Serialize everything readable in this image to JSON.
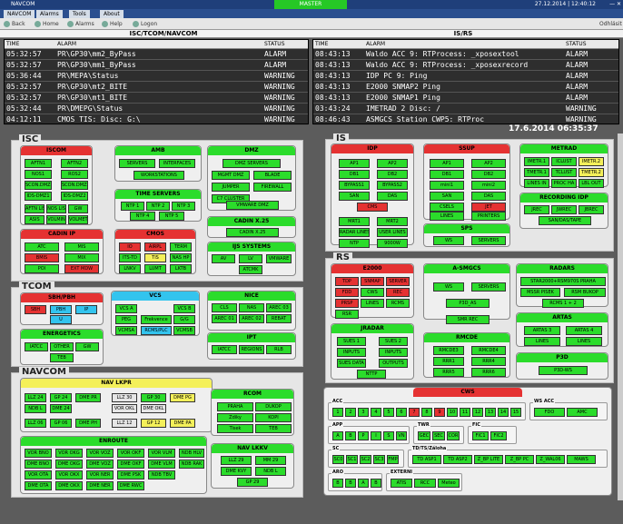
{
  "app": {
    "title": "NAVCOM",
    "master": "MASTER",
    "datetime": "27.12.2014 | 12:40:12",
    "winbtns": "— ✕",
    "offline": "Odhlásit"
  },
  "menu": [
    "NAVCOM",
    "Alarms",
    "Tools",
    "About"
  ],
  "toolbar": [
    "Back",
    "Home",
    "Alarms",
    "Help",
    "Logon"
  ],
  "logs": {
    "left_title": "ISC/TCOM/NAVCOM",
    "right_title": "IS/RS",
    "headers": {
      "time": "TIME",
      "alarm": "ALARM",
      "status": "STATUS"
    },
    "left": [
      [
        "05:32:57",
        "PR\\GP30\\mm2_ByPass",
        "ALARM"
      ],
      [
        "05:32:57",
        "PR\\GP30\\mm1_ByPass",
        "ALARM"
      ],
      [
        "05:36:44",
        "PR\\MEPA\\Status",
        "WARNING"
      ],
      [
        "05:32:57",
        "PR\\GP30\\mt2_BITE",
        "WARNING"
      ],
      [
        "05:32:57",
        "PR\\GP30\\mt1_BITE",
        "WARNING"
      ],
      [
        "05:32:44",
        "PR\\DMEPG\\Status",
        "WARNING"
      ],
      [
        "04:12:11",
        "CMOS TIS: Disc: G:\\",
        "WARNING"
      ]
    ],
    "right": [
      [
        "08:43:13",
        "Waldo ACC 9: RTProcess: _xposextool",
        "ALARM"
      ],
      [
        "08:43:13",
        "Waldo ACC 9: RTProcess: _xposexrecord",
        "ALARM"
      ],
      [
        "08:43:13",
        "IDP PC 9: Ping",
        "ALARM"
      ],
      [
        "08:43:13",
        "E2000 SNMAP2 Ping",
        "ALARM"
      ],
      [
        "08:43:13",
        "E2000 SNMAP1 Ping",
        "ALARM"
      ],
      [
        "03:43:24",
        "IMETRAD 2 Disc: /",
        "WARNING"
      ],
      [
        "08:46:43",
        "ASMGCS Station CWP5: RTProc",
        "WARNING"
      ]
    ]
  },
  "clock": "17.6.2014 06:35:37",
  "groups": {
    "isc": "ISC",
    "tcom": "TCOM",
    "navcom": "NAVCOM",
    "is": "IS",
    "rs": "RS"
  },
  "panels": {
    "iscom": {
      "title": "ISCOM",
      "buttons": [
        "AFTN1",
        "AFTN2",
        "NOS1",
        "ROS2",
        "SCON.DMZ1",
        "SCON.DMZ2",
        "IDS-DMZ1",
        "IDS-DMZ2",
        "AFTN LIS",
        "NOS LIS",
        "GW",
        "ASIS",
        "VOLMIN",
        "VOLMET"
      ]
    },
    "amb": {
      "title": "AMB",
      "buttons": [
        "SERVERS",
        "INTERFACES",
        "WORKSTATIONS"
      ]
    },
    "dmz": {
      "title": "DMZ",
      "buttons": [
        "DMZ SERVERS",
        "MGMT DMZ",
        "BLADE",
        "JUMPER",
        "FIREWALL",
        "C7 CLUSTER",
        "VMWARE DMZ"
      ]
    },
    "timeservers": {
      "title": "TIME SERVERS",
      "buttons": [
        "NTP 1",
        "NTP 2",
        "NTP 3",
        "NTP 4",
        "NTP 5"
      ]
    },
    "cadinx25": {
      "title": "CADIN X.25",
      "buttons": [
        "CADIN X.25"
      ]
    },
    "cadinip": {
      "title": "CADIN IP",
      "buttons": [
        "ATC",
        "MIS",
        "BMIS",
        "MIX",
        "POI",
        "EXT MDW"
      ]
    },
    "cmos": {
      "title": "CMOS",
      "buttons": [
        "IO",
        "AIRPL",
        "TERM",
        "ITS-TD",
        "TIS",
        "NAS HP",
        "LNKV",
        "LUMT",
        "LKTB"
      ]
    },
    "ijssystems": {
      "title": "IJS SYSTEMS",
      "buttons": [
        "AV",
        "LV",
        "VMWARE",
        "ATCMK"
      ]
    },
    "sbhpbh": {
      "title": "SBH/PBH",
      "buttons": [
        "SBH",
        "PBH",
        "IP",
        "U"
      ]
    },
    "vcs": {
      "title": "VCS",
      "buttons": [
        "VCS A",
        "VCS B",
        "PEG",
        "Frekvence",
        "G/G",
        "VCMSA",
        "RCMS/PLC",
        "VCMSB"
      ]
    },
    "nice": {
      "title": "NICE",
      "buttons": [
        "CLS",
        "NAS",
        "AREC 03",
        "AREC 01",
        "AREC 02",
        "REBAT"
      ]
    },
    "energetics": {
      "title": "ENERGETICS",
      "buttons": [
        "IATCC",
        "OTHER",
        "GW",
        "TEB"
      ]
    },
    "ipt": {
      "title": "IPT",
      "buttons": [
        "IATCC",
        "REGIONS",
        "RLB"
      ]
    },
    "navlkpr": {
      "title": "NAV LKPR",
      "buttons": [
        "LLZ 24",
        "GP 24",
        "DME PR",
        "NDB L",
        "DME 24",
        "LLZ 06",
        "GP 06",
        "DME PH",
        "LLZ 30",
        "GP 30",
        "DME PG",
        "VOR OKL",
        "DME OKL",
        "LLZ 12",
        "GP 12",
        "DME PA"
      ]
    },
    "rcom": {
      "title": "RCOM",
      "buttons": [
        "PRAHA",
        "DUKOP",
        "Zdiky",
        "KOPI",
        "Tisek",
        "TEB"
      ]
    },
    "enroute": {
      "title": "ENROUTE",
      "buttons": [
        "VOR BNO",
        "VOR OKG",
        "VOR VOZ",
        "VOR OKF",
        "VOR VLM",
        "NDB HLV",
        "DME BNO",
        "DME OKG",
        "DME VOZ",
        "DME OKF",
        "DME VLM",
        "NDB RAK",
        "VOR OTA",
        "VOR OKX",
        "VOR NER",
        "DME PSK",
        "NDB TBV",
        "DME OTA",
        "DME OKX",
        "DME NER",
        "DME RWC"
      ]
    },
    "navlkkv": {
      "title": "NAV LKKV",
      "buttons": [
        "LLZ 29",
        "MM 29",
        "DME KVY",
        "NDB L",
        "GP 29"
      ]
    },
    "idp": {
      "title": "IDP",
      "buttons": [
        "AP1",
        "AP2",
        "DB1",
        "DB2",
        "BYPASS1",
        "BYPASS2",
        "SAN",
        "DAS",
        "CMS",
        "MRT1",
        "MRT2",
        "RADAR LINES",
        "USER LINES",
        "NTP",
        "9000W"
      ],
      "sub": "TRACKER/PLOTER"
    },
    "ssup": {
      "title": "SSUP",
      "buttons": [
        "AP1",
        "AP2",
        "DB1",
        "DB2",
        "mini1",
        "mini2",
        "SAN",
        "DAS",
        "CSELS",
        "JET",
        "LINES",
        "PRINTERS"
      ]
    },
    "sps": {
      "title": "SPS",
      "buttons": [
        "WS",
        "SERVERS"
      ]
    },
    "metrad": {
      "title": "METRAD",
      "buttons": [
        "IMETR.1",
        "ICLUST",
        "IMETR.2",
        "TMETR.1",
        "TCLUST",
        "TMETR.2",
        "LINES IN",
        "PROC HA",
        "LBL OUT"
      ]
    },
    "recordingidp": {
      "title": "RECORDING IDP",
      "buttons": [
        "JREC",
        "JWREC",
        "JBREC",
        "SAN/DAS/TAPE"
      ]
    },
    "e2000": {
      "title": "E2000",
      "buttons": [
        "TDP",
        "SNMAP",
        "SERVER",
        "FDD",
        "CWS",
        "REC",
        "PRSP",
        "LINES",
        "RCMS",
        "RSR"
      ]
    },
    "asmgcs": {
      "title": "A-SMGCS",
      "buttons": [
        "WS",
        "SERVERS",
        "P3D_AS",
        "SMR REC"
      ],
      "sub1": "HOVA 3000",
      "sub2": "P3D_AS",
      "sub3": "SMR REC"
    },
    "radars": {
      "title": "RADARS",
      "buttons": [
        "STAR2000+RSM970S PRAHA",
        "MSSR PISEK",
        "RSM BUKOP",
        "RCMS 1 + 2"
      ]
    },
    "jradar": {
      "title": "JRADAR",
      "buttons": [
        "SUES 1",
        "SUES 2",
        "INPUTS",
        "INPUTS",
        "SUES DATA",
        "OUTPUTS",
        "NTTP"
      ]
    },
    "rmcde": {
      "title": "RMCDE",
      "buttons": [
        "RMCDE3",
        "RMCDE4",
        "RRR1",
        "RRR4",
        "RRR5",
        "RRR6"
      ]
    },
    "artas": {
      "title": "ARTAS",
      "buttons": [
        "ARTAS 3",
        "ARTAS 4",
        "LINES",
        "LINES"
      ]
    },
    "p3d": {
      "title": "P3D",
      "buttons": [
        "P3D-WS"
      ]
    },
    "cws": {
      "title": "CWS",
      "acc": "ACC",
      "wsacc": "WS ACC",
      "app": "APP",
      "twr": "TWR",
      "fic": "FIC",
      "sc": "SC",
      "tdts": "TD/TS/Záloha",
      "ario": "ARO",
      "extern": "EXTERNI",
      "acc_buttons": [
        "1",
        "2",
        "3",
        "4",
        "5",
        "6",
        "7",
        "8",
        "9",
        "10",
        "11",
        "12",
        "13",
        "14",
        "15"
      ],
      "wsacc_buttons": [
        "FDO",
        "AMC"
      ],
      "app_buttons": [
        "A",
        "B",
        "P",
        "I",
        "S",
        "VN"
      ],
      "twr_buttons": [
        "GEC",
        "SEC",
        "COR"
      ],
      "fic_buttons": [
        "FIC1",
        "FIC2"
      ],
      "sc_buttons": [
        "SC0",
        "SC1",
        "SC2",
        "SC3",
        "FMP"
      ],
      "td_buttons": [
        "TD ASP1",
        "TD ASP2",
        "Z_BP LITE",
        "Z_BP PC",
        "Z_WAL06",
        "MAWS"
      ],
      "aro_buttons": [
        "B",
        "B",
        "A",
        "B"
      ],
      "ext_buttons": [
        "ATIS",
        "RCC",
        "Meteo"
      ]
    }
  },
  "colors": {
    "ok": "#2bdc2b",
    "alarm": "#e53232",
    "info": "#33c4ee",
    "warn": "#f4f05a"
  }
}
